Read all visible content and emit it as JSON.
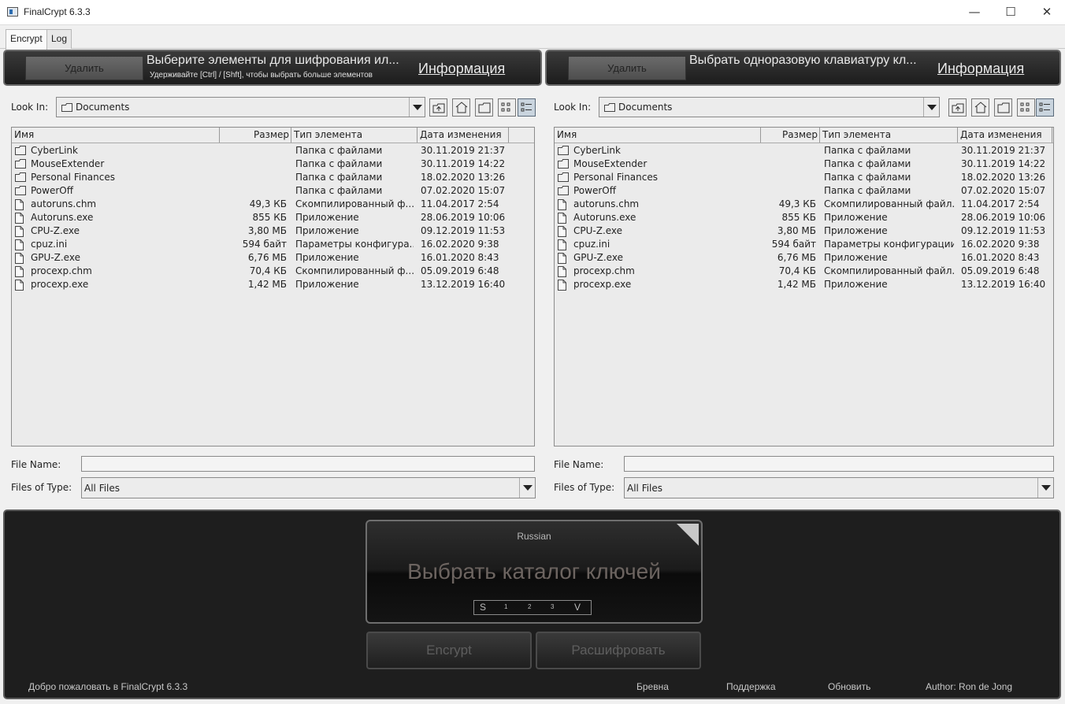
{
  "window": {
    "title": "FinalCrypt 6.3.3",
    "minimize": "—",
    "maximize": "☐",
    "close": "✕"
  },
  "tabs": [
    "Encrypt",
    "Log"
  ],
  "left_bar": {
    "delete_label": "Удалить",
    "main_text": "Выберите элементы для шифрования ил...",
    "sub_text": "Удерживайте [Ctrl] / [Shft], чтобы выбрать больше элементов",
    "info_label": "Информация"
  },
  "right_bar": {
    "delete_label": "Удалить",
    "main_text": "Выбрать одноразовую клавиатуру кл...",
    "info_label": "Информация"
  },
  "chooser": {
    "look_in_label": "Look In:",
    "look_in_value": "Documents",
    "file_name_label": "File Name:",
    "file_name_value": "",
    "files_of_type_label": "Files of Type:",
    "files_of_type_value": "All Files",
    "columns": [
      "Имя",
      "Размер",
      "Тип элемента",
      "Дата изменения"
    ]
  },
  "left_files": [
    {
      "name": "CyberLink",
      "size": "",
      "type": "Папка с файлами",
      "date": "30.11.2019 21:37",
      "icon": "folder-icon"
    },
    {
      "name": "MouseExtender",
      "size": "",
      "type": "Папка с файлами",
      "date": "30.11.2019 14:22",
      "icon": "folder-icon"
    },
    {
      "name": "Personal Finances",
      "size": "",
      "type": "Папка с файлами",
      "date": "18.02.2020 13:26",
      "icon": "folder-icon"
    },
    {
      "name": "PowerOff",
      "size": "",
      "type": "Папка с файлами",
      "date": "07.02.2020 15:07",
      "icon": "folder-icon"
    },
    {
      "name": "autoruns.chm",
      "size": "49,3 КБ",
      "type": "Скомпилированный ф...",
      "date": "11.04.2017 2:54",
      "icon": "file-icon"
    },
    {
      "name": "Autoruns.exe",
      "size": "855 КБ",
      "type": "Приложение",
      "date": "28.06.2019 10:06",
      "icon": "file-icon"
    },
    {
      "name": "CPU-Z.exe",
      "size": "3,80 МБ",
      "type": "Приложение",
      "date": "09.12.2019 11:53",
      "icon": "file-icon"
    },
    {
      "name": "cpuz.ini",
      "size": "594 байт",
      "type": "Параметры конфигура...",
      "date": "16.02.2020 9:38",
      "icon": "file-icon"
    },
    {
      "name": "GPU-Z.exe",
      "size": "6,76 МБ",
      "type": "Приложение",
      "date": "16.01.2020 8:43",
      "icon": "file-icon"
    },
    {
      "name": "procexp.chm",
      "size": "70,4 КБ",
      "type": "Скомпилированный ф...",
      "date": "05.09.2019 6:48",
      "icon": "file-icon"
    },
    {
      "name": "procexp.exe",
      "size": "1,42 МБ",
      "type": "Приложение",
      "date": "13.12.2019 16:40",
      "icon": "file-icon"
    }
  ],
  "right_files": [
    {
      "name": "CyberLink",
      "size": "",
      "type": "Папка с файлами",
      "date": "30.11.2019 21:37",
      "icon": "folder-icon"
    },
    {
      "name": "MouseExtender",
      "size": "",
      "type": "Папка с файлами",
      "date": "30.11.2019 14:22",
      "icon": "folder-icon"
    },
    {
      "name": "Personal Finances",
      "size": "",
      "type": "Папка с файлами",
      "date": "18.02.2020 13:26",
      "icon": "folder-icon"
    },
    {
      "name": "PowerOff",
      "size": "",
      "type": "Папка с файлами",
      "date": "07.02.2020 15:07",
      "icon": "folder-icon"
    },
    {
      "name": "autoruns.chm",
      "size": "49,3 КБ",
      "type": "Скомпилированный файл...",
      "date": "11.04.2017 2:54",
      "icon": "file-icon"
    },
    {
      "name": "Autoruns.exe",
      "size": "855 КБ",
      "type": "Приложение",
      "date": "28.06.2019 10:06",
      "icon": "file-icon"
    },
    {
      "name": "CPU-Z.exe",
      "size": "3,80 МБ",
      "type": "Приложение",
      "date": "09.12.2019 11:53",
      "icon": "file-icon"
    },
    {
      "name": "cpuz.ini",
      "size": "594 байт",
      "type": "Параметры конфигурации",
      "date": "16.02.2020 9:38",
      "icon": "file-icon"
    },
    {
      "name": "GPU-Z.exe",
      "size": "6,76 МБ",
      "type": "Приложение",
      "date": "16.01.2020 8:43",
      "icon": "file-icon"
    },
    {
      "name": "procexp.chm",
      "size": "70,4 КБ",
      "type": "Скомпилированный файл...",
      "date": "05.09.2019 6:48",
      "icon": "file-icon"
    },
    {
      "name": "procexp.exe",
      "size": "1,42 МБ",
      "type": "Приложение",
      "date": "13.12.2019 16:40",
      "icon": "file-icon"
    }
  ],
  "key_panel": {
    "language": "Russian",
    "title": "Выбрать каталог ключей",
    "slider_labels": [
      "S",
      "1",
      "2",
      "3",
      "V"
    ]
  },
  "actions": {
    "encrypt": "Encrypt",
    "decrypt": "Расшифровать"
  },
  "status_bar": {
    "welcome": "Добро пожаловать в FinalCrypt 6.3.3",
    "logs": "Бревна",
    "support": "Поддержка",
    "update": "Обновить",
    "author": "Author: Ron de Jong"
  }
}
